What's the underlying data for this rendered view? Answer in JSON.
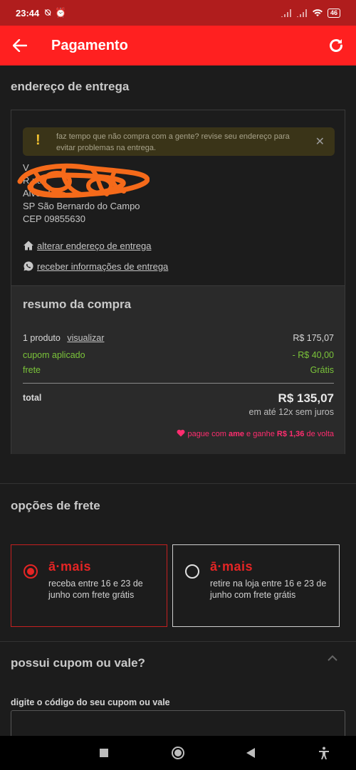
{
  "status_bar": {
    "time": "23:44",
    "battery": "46"
  },
  "app_bar": {
    "title": "Pagamento"
  },
  "address": {
    "section_title": "endereço de entrega",
    "warning_text": "faz tempo que não compra com a gente? revise seu endereço para evitar problemas na entrega.",
    "lines": [
      "V",
      "R                              ria",
      "Alves Dia",
      "SP  São Bernardo do Campo",
      "CEP 09855630"
    ],
    "change_link": "alterar endereço de entrega",
    "info_link": "receber informações de entrega"
  },
  "summary": {
    "title": "resumo da compra",
    "products_label": "1 produto",
    "view_link": "visualizar",
    "products_value": "R$ 175,07",
    "coupon_label": "cupom aplicado",
    "coupon_value": "- R$ 40,00",
    "shipping_label": "frete",
    "shipping_value": "Grátis",
    "total_label": "total",
    "total_value": "R$ 135,07",
    "installments": "em até 12x sem juros",
    "ame_prefix": "pague com",
    "ame_brand": "ame",
    "ame_middle": "e ganhe",
    "ame_value": "R$ 1,36",
    "ame_suffix": "de volta"
  },
  "shipping": {
    "section_title": "opções de frete",
    "options": [
      {
        "brand": "ā·mais",
        "description": "receba entre 16 e 23 de junho com frete grátis",
        "selected": true
      },
      {
        "brand": "ā·mais",
        "description": "retire na loja entre 16 e 23 de junho com frete grátis",
        "selected": false
      }
    ]
  },
  "coupon": {
    "section_title": "possui cupom ou vale?",
    "field_label": "digite o código do seu cupom ou vale",
    "value": ""
  },
  "colors": {
    "app_bar": "#ff2020",
    "status_bar": "#b01d1d",
    "accent_green": "#7bc43a",
    "ame_pink": "#ff2d6f",
    "brand_red": "#e52525"
  },
  "icons": {
    "back": "arrow-left-icon",
    "refresh": "refresh-icon",
    "warning": "exclamation-icon",
    "close": "close-icon",
    "home": "home-icon",
    "whatsapp": "whatsapp-icon",
    "heart": "heart-icon",
    "chevron": "chevron-up-icon"
  }
}
